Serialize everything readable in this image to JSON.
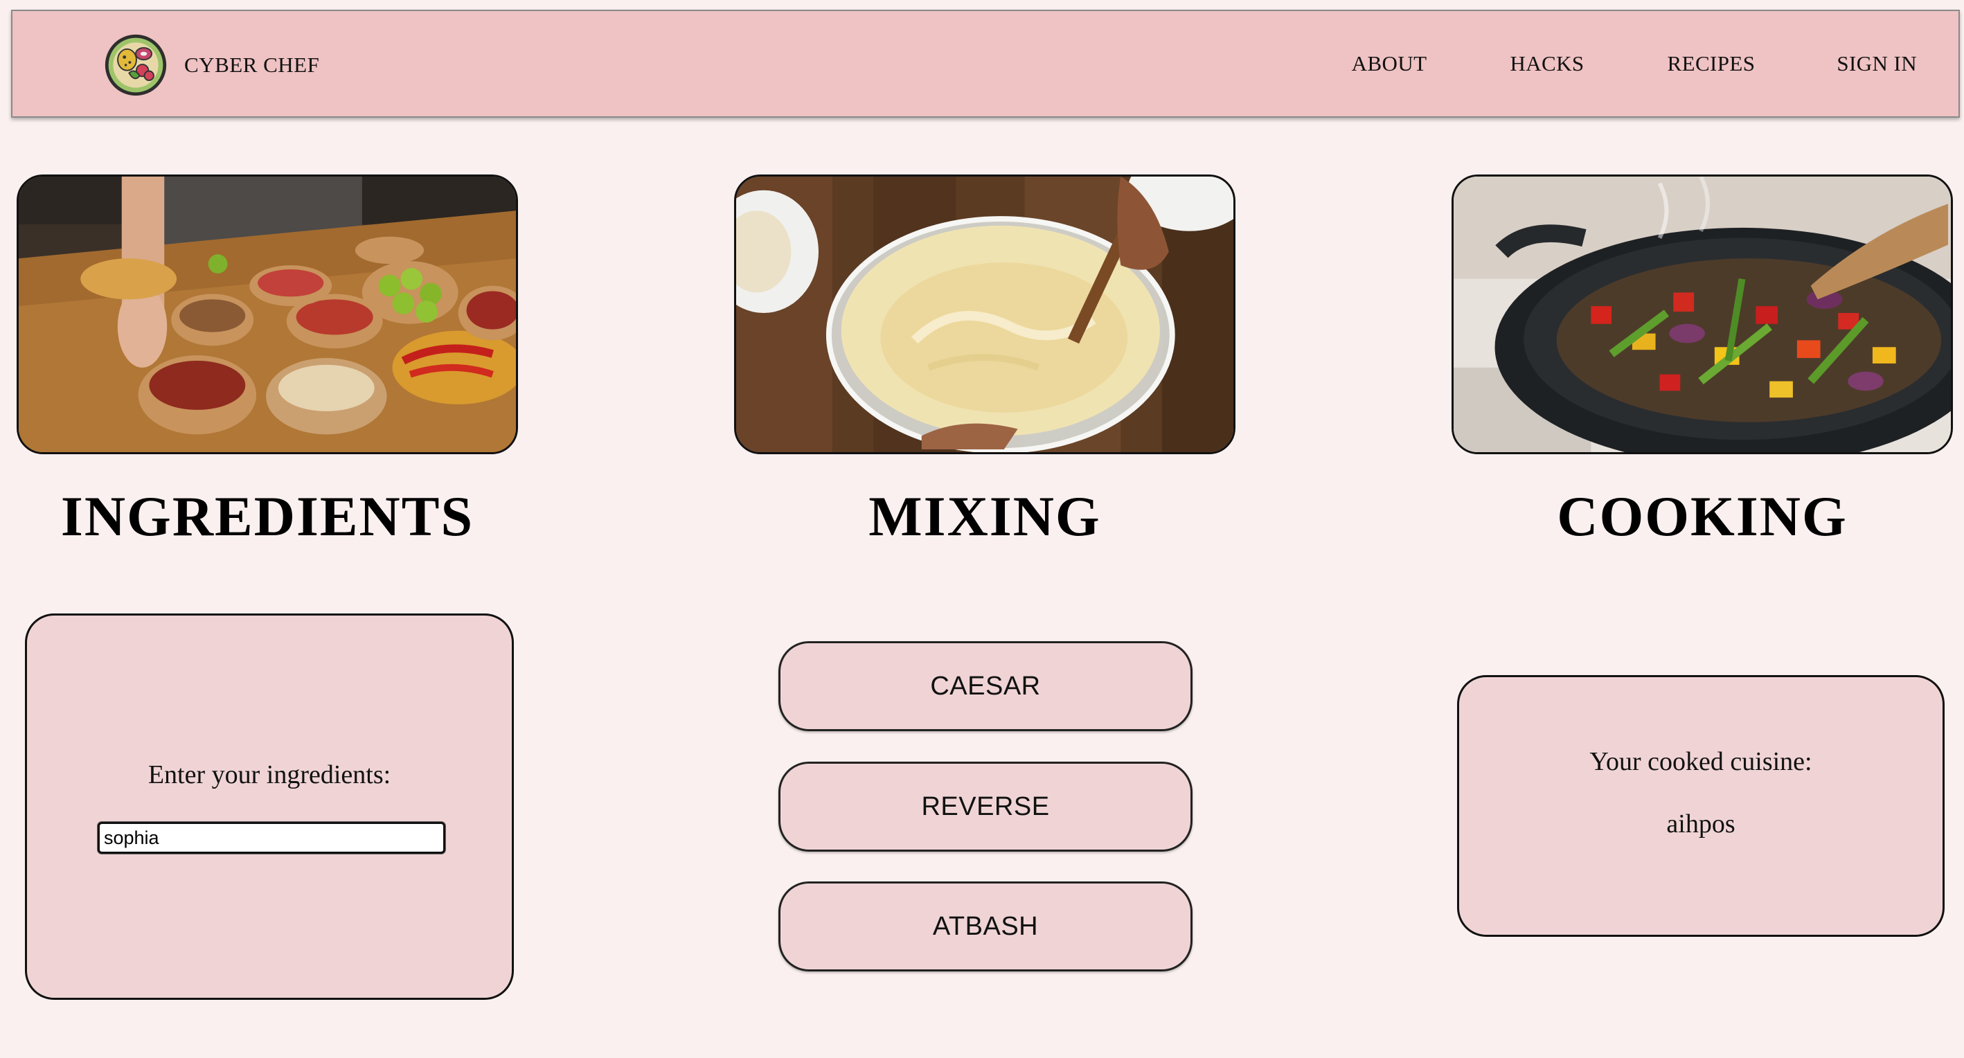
{
  "navbar": {
    "brand": "CYBER CHEF",
    "logo_icon": "food-plate-logo-icon",
    "links": [
      "ABOUT",
      "HACKS",
      "RECIPES",
      "SIGN IN"
    ]
  },
  "columns": {
    "ingredients": {
      "title": "INGREDIENTS",
      "image": "spice-bowls-photo",
      "label": "Enter your ingredients:",
      "input_value": "sophia"
    },
    "mixing": {
      "title": "MIXING",
      "image": "batter-bowl-photo",
      "buttons": [
        "CAESAR",
        "REVERSE",
        "ATBASH"
      ]
    },
    "cooking": {
      "title": "COOKING",
      "image": "wok-vegetables-photo",
      "label": "Your cooked cuisine:",
      "output": "aihpos"
    }
  },
  "colors": {
    "page_background": "#fbf0f0",
    "navbar_background": "#efc2c3",
    "card_background": "#f0d4d5",
    "border": "#111111"
  }
}
